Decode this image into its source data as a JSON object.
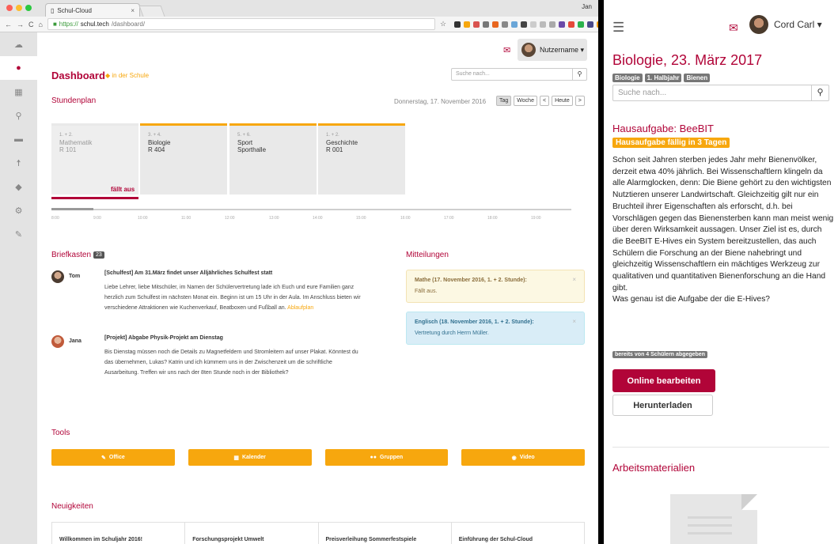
{
  "browser": {
    "tab_title": "Schul-Cloud",
    "tab_close": "×",
    "os_user": "Jan",
    "url": {
      "scheme": "https://",
      "host": "schul.tech",
      "path": "/dashboard/"
    },
    "colors": {
      "accent": "#b10438",
      "warning": "#f7a70e"
    }
  },
  "sidebar": {
    "items": [
      {
        "icon": "cloud-icon"
      },
      {
        "icon": "user-icon",
        "active": true
      },
      {
        "icon": "calendar-icon"
      },
      {
        "icon": "search-icon"
      },
      {
        "icon": "folder-icon"
      },
      {
        "icon": "child-icon"
      },
      {
        "icon": "graduation-cap-icon"
      },
      {
        "icon": "gears-icon"
      },
      {
        "icon": "wrench-icon"
      }
    ]
  },
  "header": {
    "user_name": "Nutzername ▾",
    "search_placeholder": "Suche nach..."
  },
  "dashboard": {
    "title": "Dashboard",
    "subtitle": "in der Schule"
  },
  "schedule": {
    "title": "Stundenplan",
    "date": "Donnerstag, 17. November 2016",
    "buttons": {
      "day": "Tag",
      "week": "Woche",
      "prev": "<",
      "today": "Heute",
      "next": ">"
    },
    "lessons": [
      {
        "time": "1. + 2.",
        "subject": "Mathematik",
        "room": "R 101",
        "status": "fällt aus"
      },
      {
        "time": "3. + 4.",
        "subject": "Biologie",
        "room": "R 404"
      },
      {
        "time": "5. + 6.",
        "subject": "Sport",
        "room": "Sporthalle"
      },
      {
        "time": "1. + 2.",
        "subject": "Geschichte",
        "room": "R 001"
      }
    ],
    "ticks": [
      "8:00",
      "9:00",
      "10:00",
      "11:00",
      "12:00",
      "13:00",
      "14:00",
      "15:00",
      "16:00",
      "17:00",
      "18:00",
      "19:00"
    ]
  },
  "mailbox": {
    "title": "Briefkasten",
    "count": "23",
    "messages": [
      {
        "name": "Tom",
        "subject": "[Schulfest] Am 31.März findet unser Alljährliches Schulfest statt",
        "body": "Liebe Lehrer, liebe Mitschüler, im Namen der Schülervertretung lade ich Euch und eure Familien ganz herzlich zum Schulfest im nächsten Monat ein. Beginn ist um 15 Uhr in der Aula. Im Anschluss bieten wir verschiedene Attraktionen wie Kuchenverkauf, Beatboxen und Fußball an.",
        "link": "Ablaufplan"
      },
      {
        "name": "Jana",
        "subject": "[Projekt] Abgabe Physik-Projekt am Dienstag",
        "body": "Bis Dienstag müssen noch die Details zu Magnetfeldern und Stromleitern auf unser Plakat. Könntest du das übernehmen, Lukas? Katrin und ich kümmern uns in der Zwischenzeit um die schriftliche Ausarbeitung. Treffen wir uns nach der 8ten Stunde noch in der Bibliothek?"
      }
    ]
  },
  "notices": {
    "title": "Mitteilungen",
    "items": [
      {
        "title": "Mathe (17. November 2016, 1. + 2. Stunde):",
        "text": "Fällt aus.",
        "close": "×"
      },
      {
        "title": "Englisch (18. November 2016, 1. + 2. Stunde):",
        "text": "Vertretung durch Herrn Müller.",
        "close": "×"
      }
    ]
  },
  "tools": {
    "title": "Tools",
    "items": [
      {
        "label": "Office",
        "icon": "pencil-icon"
      },
      {
        "label": "Kalender",
        "icon": "calendar-icon"
      },
      {
        "label": "Gruppen",
        "icon": "users-icon"
      },
      {
        "label": "Video",
        "icon": "camera-icon"
      }
    ]
  },
  "news": {
    "title": "Neuigkeiten",
    "items": [
      "Willkommen im Schuljahr 2016!",
      "Forschungsprojekt Umwelt",
      "Preisverleihung Sommerfestspiele",
      "Einführung der Schul-Cloud"
    ]
  },
  "mobile": {
    "user_name": "Cord Carl ▾",
    "title": "Biologie, 23. März 2017",
    "tags": [
      "Biologie",
      "1. Halbjahr",
      "Bienen"
    ],
    "search_placeholder": "Suche nach...",
    "homework_title": "Hausaufgabe: BeeBIT",
    "due": "Hausaufgabe fällig in 3 Tagen",
    "text": "Schon seit Jahren sterben jedes Jahr mehr Bienenvölker, derzeit etwa 40% jährlich. Bei Wissenschaftlern klingeln da alle Alarmglocken, denn: Die Biene gehört zu den wichtigsten Nutztieren unserer Landwirtschaft. Gleichzeitig gilt nur ein Bruchteil ihrer Eigenschaften als erforscht, d.h. bei Vorschlägen gegen das Bienensterben kann man meist wenig über deren Wirksamkeit aussagen. Unser Ziel ist es, durch die BeeBIT E-Hives ein System bereitzustellen, das auch Schülern die Forschung an der Biene nahebringt und gleichzeitig Wissenschaftlern ein mächtiges Werkzeug zur qualitativen und quantitativen Bienenforschung an die Hand gibt.",
    "question": "Was genau ist die Aufgabe der die E-Hives?",
    "submitted": "bereits von 4 Schülern abgegeben",
    "edit_online": "Online bearbeiten",
    "download": "Herunterladen",
    "materials_title": "Arbeitsmaterialien"
  }
}
